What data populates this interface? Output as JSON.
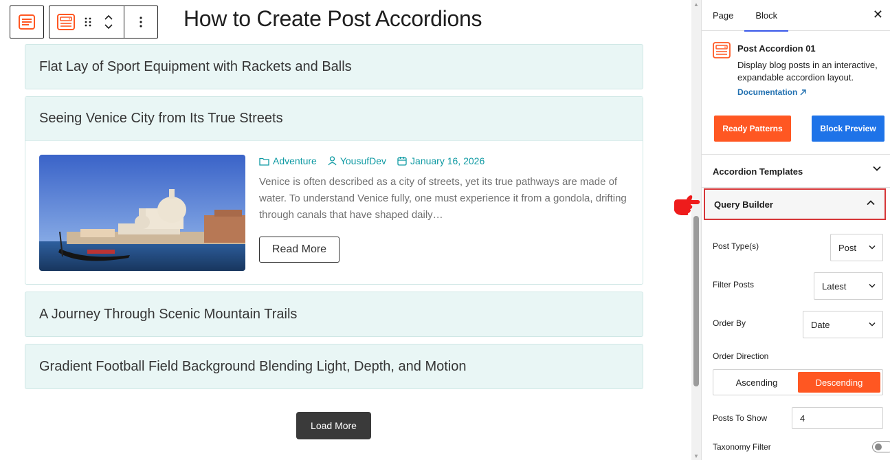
{
  "editor": {
    "page_title": "How to Create Post Accordions"
  },
  "accordion": {
    "items": [
      {
        "title": "Flat Lay of Sport Equipment with Rackets and Balls"
      },
      {
        "title": "Seeing Venice City from Its True Streets",
        "category": "Adventure",
        "author": "YousufDev",
        "date": "January 16, 2026",
        "excerpt": "Venice is often described as a city of streets, yet its true pathways are made of water. To understand Venice fully, one must experience it from a gondola, drifting through canals that have shaped daily…",
        "read_more_label": "Read More"
      },
      {
        "title": "A Journey Through Scenic Mountain Trails"
      },
      {
        "title": "Gradient Football Field Background Blending Light, Depth, and Motion"
      }
    ],
    "load_more_label": "Load More"
  },
  "sidebar": {
    "tabs": [
      "Page",
      "Block"
    ],
    "active_tab": "Block",
    "block": {
      "name": "Post Accordion 01",
      "description": "Display blog posts in an interactive, expandable accordion layout.",
      "doc_link": "Documentation"
    },
    "buttons": {
      "ready_patterns": "Ready Patterns",
      "block_preview": "Block Preview"
    },
    "panels": {
      "templates": "Accordion Templates",
      "query_builder": "Query Builder"
    },
    "query": {
      "post_types_label": "Post Type(s)",
      "post_types_value": "Post",
      "filter_label": "Filter Posts",
      "filter_value": "Latest",
      "order_by_label": "Order By",
      "order_by_value": "Date",
      "direction_label": "Order Direction",
      "direction_options": [
        "Ascending",
        "Descending"
      ],
      "direction_selected": "Descending",
      "posts_to_show_label": "Posts To Show",
      "posts_to_show_value": "4",
      "taxonomy_filter_label": "Taxonomy Filter",
      "taxonomy_filter_enabled": false
    }
  },
  "colors": {
    "accent_orange": "#ff5722",
    "accent_blue": "#1e73e8",
    "teal_meta": "#0f9aa3",
    "accordion_bg": "#e9f6f5",
    "highlight_red": "#d63638"
  }
}
